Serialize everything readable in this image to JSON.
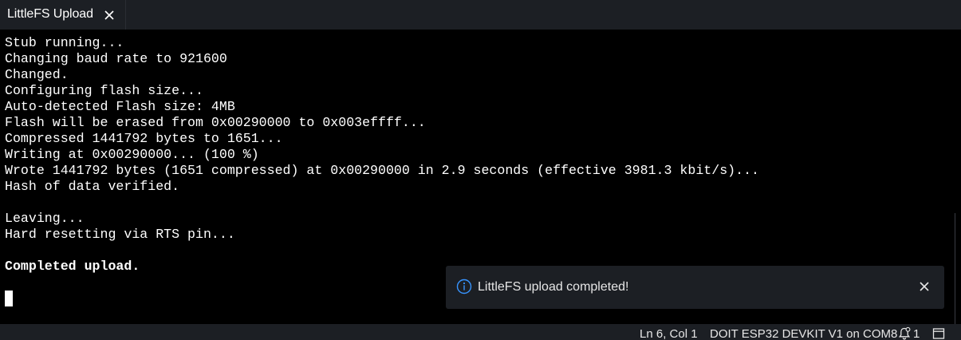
{
  "tab": {
    "title": "LittleFS Upload",
    "close_icon": "close-icon"
  },
  "console": {
    "lines": [
      "Stub running...",
      "Changing baud rate to 921600",
      "Changed.",
      "Configuring flash size...",
      "Auto-detected Flash size: 4MB",
      "Flash will be erased from 0x00290000 to 0x003effff...",
      "Compressed 1441792 bytes to 1651...",
      "Writing at 0x00290000... (100 %)",
      "Wrote 1441792 bytes (1651 compressed) at 0x00290000 in 2.9 seconds (effective 3981.3 kbit/s)...",
      "Hash of data verified.",
      "",
      "Leaving...",
      "Hard resetting via RTS pin...",
      "",
      "Completed upload."
    ]
  },
  "notification": {
    "message": "LittleFS upload completed!",
    "icon": "info-icon",
    "close_icon": "close-icon",
    "accent_color": "#3794ff"
  },
  "statusbar": {
    "cursor_position": "Ln 6, Col 1",
    "board": "DOIT ESP32 DEVKIT V1 on COM8",
    "notification_count": "1",
    "bell_icon": "bell-icon",
    "panel_icon": "panel-icon"
  }
}
